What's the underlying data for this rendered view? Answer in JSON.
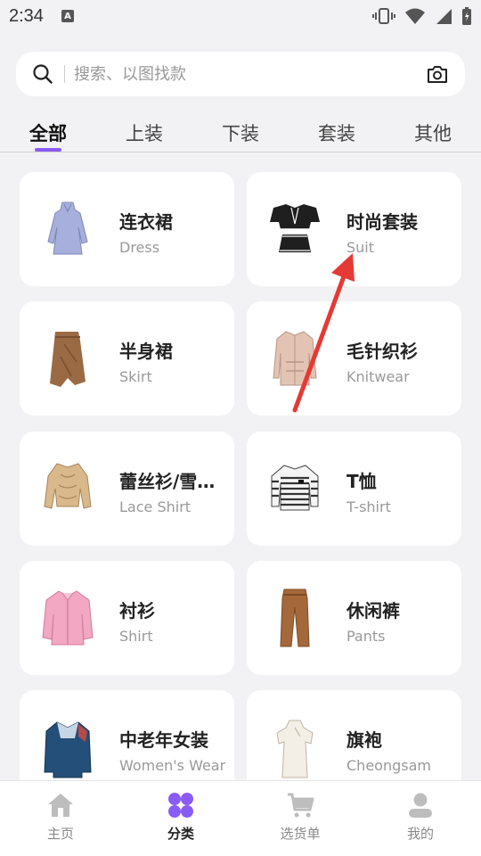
{
  "status_bar": {
    "time": "2:34",
    "badge": "A"
  },
  "search": {
    "placeholder": "搜索、以图找款"
  },
  "tabs": [
    {
      "label": "全部",
      "active": true
    },
    {
      "label": "上装",
      "active": false
    },
    {
      "label": "下装",
      "active": false
    },
    {
      "label": "套装",
      "active": false
    },
    {
      "label": "其他",
      "active": false
    }
  ],
  "categories": [
    {
      "cn": "连衣裙",
      "en": "Dress",
      "icon": "dress-icon"
    },
    {
      "cn": "时尚套装",
      "en": "Suit",
      "icon": "suit-icon"
    },
    {
      "cn": "半身裙",
      "en": "Skirt",
      "icon": "skirt-icon"
    },
    {
      "cn": "毛针织衫",
      "en": "Knitwear",
      "icon": "knitwear-icon"
    },
    {
      "cn": "蕾丝衫/雪…",
      "en": "Lace Shirt",
      "icon": "lace-shirt-icon"
    },
    {
      "cn": "T恤",
      "en": "T-shirt",
      "icon": "tshirt-icon"
    },
    {
      "cn": "衬衫",
      "en": "Shirt",
      "icon": "shirt-icon"
    },
    {
      "cn": "休闲裤",
      "en": "Pants",
      "icon": "pants-icon"
    },
    {
      "cn": "中老年女装",
      "en": "Women's Wear",
      "icon": "womens-wear-icon"
    },
    {
      "cn": "旗袍",
      "en": "Cheongsam",
      "icon": "cheongsam-icon"
    }
  ],
  "bottom_nav": [
    {
      "label": "主页",
      "icon": "home-icon",
      "active": false
    },
    {
      "label": "分类",
      "icon": "category-icon",
      "active": true
    },
    {
      "label": "选货单",
      "icon": "cart-icon",
      "active": false
    },
    {
      "label": "我的",
      "icon": "profile-icon",
      "active": false
    }
  ],
  "colors": {
    "accent": "#8a5cf6",
    "annotation_arrow": "#e53935"
  }
}
